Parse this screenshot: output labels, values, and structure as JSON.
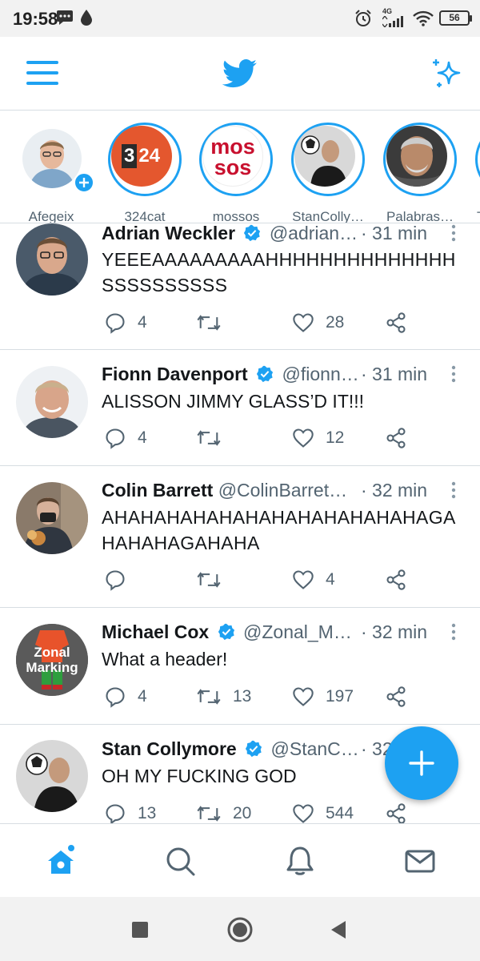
{
  "status_bar": {
    "time": "19:58",
    "network": "4G",
    "battery": "56",
    "icons": [
      "message-icon",
      "drop-icon",
      "alarm-icon",
      "signal-icon",
      "wifi-icon",
      "battery-icon"
    ]
  },
  "app_bar": {
    "logo": "twitter-bird-icon",
    "menu_icon": "hamburger-menu-icon",
    "sparkle_icon": "sparkle-icon"
  },
  "fleets": [
    {
      "name": "Afegeix"
    },
    {
      "name": "324cat",
      "logo_text_a": "3",
      "logo_text_b": "24"
    },
    {
      "name": "mossos",
      "logo_line1": "mos",
      "logo_line2": "sos"
    },
    {
      "name": "StanColly…"
    },
    {
      "name": "Palabras…"
    },
    {
      "name": "T"
    }
  ],
  "tweets": [
    {
      "author": "Adrian Weckler",
      "verified": true,
      "handle": "@adrian…",
      "time": "· 31 min",
      "text": "YEEEAAAAAAAAAHHHHHHHHHHHHHHSSSSSSSSSS",
      "replies": "4",
      "retweets": "",
      "likes": "28"
    },
    {
      "author": "Fionn Davenport",
      "verified": true,
      "handle": "@fionn…",
      "time": "· 31 min",
      "text": "ALISSON JIMMY GLASS’D IT!!!",
      "replies": "4",
      "retweets": "",
      "likes": "12"
    },
    {
      "author": "Colin Barrett",
      "verified": false,
      "handle": "@ColinBarret…",
      "time": "· 32 min",
      "text": "AHAHAHAHAHAHAHAHAHAHAHAHAGAHAHAHAGAHAHA",
      "replies": "",
      "retweets": "",
      "likes": "4"
    },
    {
      "author": "Michael Cox",
      "verified": true,
      "handle": "@Zonal_M…",
      "time": "· 32 min",
      "text": "What a header!",
      "replies": "4",
      "retweets": "13",
      "likes": "197",
      "avatar_text_1": "Zonal",
      "avatar_text_2": "Marking"
    },
    {
      "author": "Stan Collymore",
      "verified": true,
      "handle": "@StanC…",
      "time": "· 32",
      "text": "OH MY FUCKING GOD",
      "replies": "13",
      "retweets": "20",
      "likes": "544"
    }
  ],
  "fab": {
    "icon": "plus-icon"
  },
  "bottom_nav": [
    "home-icon",
    "search-icon",
    "notifications-icon",
    "messages-icon"
  ],
  "colors": {
    "accent": "#1da1f2",
    "text": "#14171a",
    "secondary": "#536471",
    "divider": "#d7dde2"
  }
}
